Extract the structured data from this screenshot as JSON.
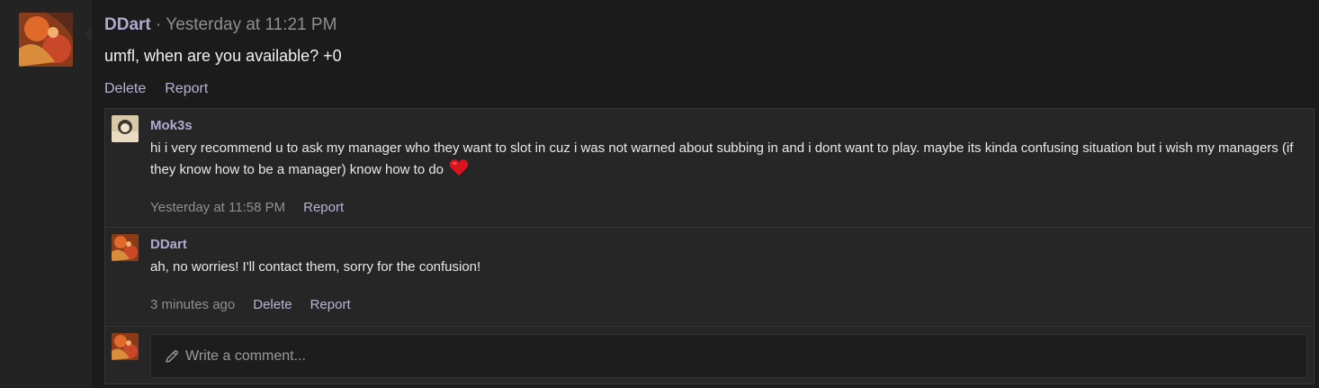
{
  "post": {
    "author": "DDart",
    "separator": "·",
    "time": "Yesterday at 11:21 PM",
    "body": "umfl, when are you available? +0",
    "actions": {
      "delete": "Delete",
      "report": "Report"
    }
  },
  "comments": [
    {
      "author": "Mok3s",
      "text": "hi i very recommend u to ask my manager who they want to slot in cuz i was not warned about subbing in and i dont want to play. maybe its kinda confusing situation but i wish my managers (if they know how to be a manager) know how to do",
      "emoji": "heart-icon",
      "time": "Yesterday at 11:58 PM",
      "report": "Report"
    },
    {
      "author": "DDart",
      "text": "ah, no worries! I'll contact them, sorry for the confusion!",
      "time": "3 minutes ago",
      "delete": "Delete",
      "report": "Report"
    }
  ],
  "composer": {
    "placeholder": "Write a comment..."
  },
  "colors": {
    "accent": "#b0a9cf",
    "background": "#1b1b1b",
    "panel": "#262626"
  }
}
